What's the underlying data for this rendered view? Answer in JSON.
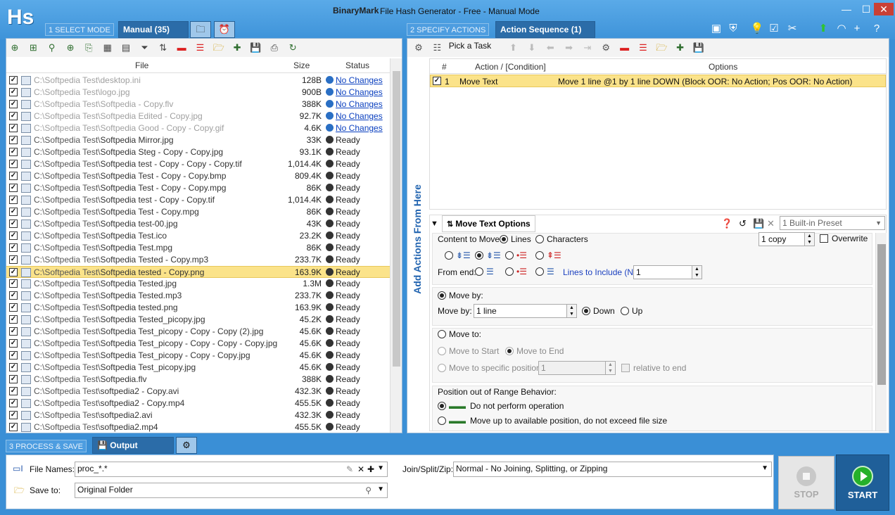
{
  "app": {
    "logo": "Hs",
    "brand": "BinaryMark",
    "title": "File Hash Generator - Free - Manual Mode"
  },
  "steps": {
    "step1": "1 SELECT MODE",
    "step2": "2 SPECIFY ACTIONS",
    "step3": "3 PROCESS & SAVE"
  },
  "tabs": {
    "manual": "Manual (35)",
    "action_sequence": "Action Sequence (1)",
    "output_settings": "Output Settings"
  },
  "file_list": {
    "columns": {
      "file": "File",
      "size": "Size",
      "status": "Status"
    },
    "rows": [
      {
        "dir": "C:\\Softpedia Test\\",
        "name": "desktop.ini",
        "size": "128B",
        "status": "No Changes",
        "gray": true,
        "sel": false
      },
      {
        "dir": "C:\\Softpedia Test\\",
        "name": "logo.jpg",
        "size": "900B",
        "status": "No Changes",
        "gray": true,
        "sel": false
      },
      {
        "dir": "C:\\Softpedia Test\\",
        "name": "Softpedia - Copy.flv",
        "size": "388K",
        "status": "No Changes",
        "gray": true,
        "sel": false
      },
      {
        "dir": "C:\\Softpedia Test\\",
        "name": "Softpedia Edited - Copy.jpg",
        "size": "92.7K",
        "status": "No Changes",
        "gray": true,
        "sel": false
      },
      {
        "dir": "C:\\Softpedia Test\\",
        "name": "Softpedia Good - Copy - Copy.gif",
        "size": "4.6K",
        "status": "No Changes",
        "gray": true,
        "sel": false
      },
      {
        "dir": "C:\\Softpedia Test\\",
        "name": "Softpedia Mirror.jpg",
        "size": "33K",
        "status": "Ready",
        "gray": false,
        "sel": false
      },
      {
        "dir": "C:\\Softpedia Test\\",
        "name": "Softpedia Steg - Copy - Copy.jpg",
        "size": "93.1K",
        "status": "Ready",
        "gray": false,
        "sel": false
      },
      {
        "dir": "C:\\Softpedia Test\\",
        "name": "Softpedia test - Copy - Copy - Copy.tif",
        "size": "1,014.4K",
        "status": "Ready",
        "gray": false,
        "sel": false
      },
      {
        "dir": "C:\\Softpedia Test\\",
        "name": "Softpedia Test - Copy - Copy.bmp",
        "size": "809.4K",
        "status": "Ready",
        "gray": false,
        "sel": false
      },
      {
        "dir": "C:\\Softpedia Test\\",
        "name": "Softpedia Test - Copy - Copy.mpg",
        "size": "86K",
        "status": "Ready",
        "gray": false,
        "sel": false
      },
      {
        "dir": "C:\\Softpedia Test\\",
        "name": "Softpedia test - Copy - Copy.tif",
        "size": "1,014.4K",
        "status": "Ready",
        "gray": false,
        "sel": false
      },
      {
        "dir": "C:\\Softpedia Test\\",
        "name": "Softpedia Test - Copy.mpg",
        "size": "86K",
        "status": "Ready",
        "gray": false,
        "sel": false
      },
      {
        "dir": "C:\\Softpedia Test\\",
        "name": "Softpedia test-00.jpg",
        "size": "43K",
        "status": "Ready",
        "gray": false,
        "sel": false
      },
      {
        "dir": "C:\\Softpedia Test\\",
        "name": "Softpedia Test.ico",
        "size": "23.2K",
        "status": "Ready",
        "gray": false,
        "sel": false
      },
      {
        "dir": "C:\\Softpedia Test\\",
        "name": "Softpedia Test.mpg",
        "size": "86K",
        "status": "Ready",
        "gray": false,
        "sel": false
      },
      {
        "dir": "C:\\Softpedia Test\\",
        "name": "Softpedia Tested - Copy.mp3",
        "size": "233.7K",
        "status": "Ready",
        "gray": false,
        "sel": false
      },
      {
        "dir": "C:\\Softpedia Test\\",
        "name": "Softpedia tested - Copy.png",
        "size": "163.9K",
        "status": "Ready",
        "gray": false,
        "sel": true
      },
      {
        "dir": "C:\\Softpedia Test\\",
        "name": "Softpedia Tested.jpg",
        "size": "1.3M",
        "status": "Ready",
        "gray": false,
        "sel": false
      },
      {
        "dir": "C:\\Softpedia Test\\",
        "name": "Softpedia Tested.mp3",
        "size": "233.7K",
        "status": "Ready",
        "gray": false,
        "sel": false
      },
      {
        "dir": "C:\\Softpedia Test\\",
        "name": "Softpedia tested.png",
        "size": "163.9K",
        "status": "Ready",
        "gray": false,
        "sel": false
      },
      {
        "dir": "C:\\Softpedia Test\\",
        "name": "Softpedia Tested_picopy.jpg",
        "size": "45.2K",
        "status": "Ready",
        "gray": false,
        "sel": false
      },
      {
        "dir": "C:\\Softpedia Test\\",
        "name": "Softpedia Test_picopy - Copy - Copy (2).jpg",
        "size": "45.6K",
        "status": "Ready",
        "gray": false,
        "sel": false
      },
      {
        "dir": "C:\\Softpedia Test\\",
        "name": "Softpedia Test_picopy - Copy - Copy - Copy.jpg",
        "size": "45.6K",
        "status": "Ready",
        "gray": false,
        "sel": false
      },
      {
        "dir": "C:\\Softpedia Test\\",
        "name": "Softpedia Test_picopy - Copy - Copy.jpg",
        "size": "45.6K",
        "status": "Ready",
        "gray": false,
        "sel": false
      },
      {
        "dir": "C:\\Softpedia Test\\",
        "name": "Softpedia Test_picopy.jpg",
        "size": "45.6K",
        "status": "Ready",
        "gray": false,
        "sel": false
      },
      {
        "dir": "C:\\Softpedia Test\\",
        "name": "Softpedia.flv",
        "size": "388K",
        "status": "Ready",
        "gray": false,
        "sel": false
      },
      {
        "dir": "C:\\Softpedia Test\\",
        "name": "softpedia2 - Copy.avi",
        "size": "432.3K",
        "status": "Ready",
        "gray": false,
        "sel": false
      },
      {
        "dir": "C:\\Softpedia Test\\",
        "name": "softpedia2 - Copy.mp4",
        "size": "455.5K",
        "status": "Ready",
        "gray": false,
        "sel": false
      },
      {
        "dir": "C:\\Softpedia Test\\",
        "name": "softpedia2.avi",
        "size": "432.3K",
        "status": "Ready",
        "gray": false,
        "sel": false
      },
      {
        "dir": "C:\\Softpedia Test\\",
        "name": "softpedia2.mp4",
        "size": "455.5K",
        "status": "Ready",
        "gray": false,
        "sel": false
      }
    ]
  },
  "actions": {
    "pick_task": "Pick a Task",
    "side_label": "Add Actions From Here",
    "columns": {
      "num": "#",
      "action": "Action / [Condition]",
      "options": "Options"
    },
    "rows": [
      {
        "num": "1",
        "action": "Move Text",
        "options": "Move 1 line @1 by 1 line DOWN (Block OOR: No Action; Pos OOR: No Action)"
      }
    ]
  },
  "options_panel": {
    "title": "Move Text Options",
    "preset": "1 Built-in Preset",
    "content_to_move": "Content to Move:",
    "lines": "Lines",
    "characters": "Characters",
    "copies": "1 copy",
    "overwrite": "Overwrite",
    "from_end": "From end:",
    "lines_to_include": "Lines to Include (N):",
    "lines_to_include_value": "1",
    "move_by_radio": "Move by:",
    "move_by_label": "Move by:",
    "move_by_value": "1 line",
    "down": "Down",
    "up": "Up",
    "move_to": "Move to:",
    "move_to_start": "Move to Start",
    "move_to_end": "Move to End",
    "move_to_specific": "Move to specific position:",
    "position_value": "1",
    "relative_to_end": "relative to end",
    "oor_title": "Position out of Range Behavior:",
    "oor_1": "Do not perform operation",
    "oor_2": "Move up to available position, do not exceed file size"
  },
  "output": {
    "file_names_label": "File Names:",
    "file_names_value": "proc_*.*",
    "save_to_label": "Save to:",
    "save_to_value": "Original Folder",
    "join_label": "Join/Split/Zip:",
    "join_value": "Normal - No Joining, Splitting, or Zipping",
    "stop": "STOP",
    "start": "START"
  },
  "colors": {
    "title_bar": "#4a9de0",
    "selection": "#fbe38a",
    "start_button": "#1f5f99"
  }
}
